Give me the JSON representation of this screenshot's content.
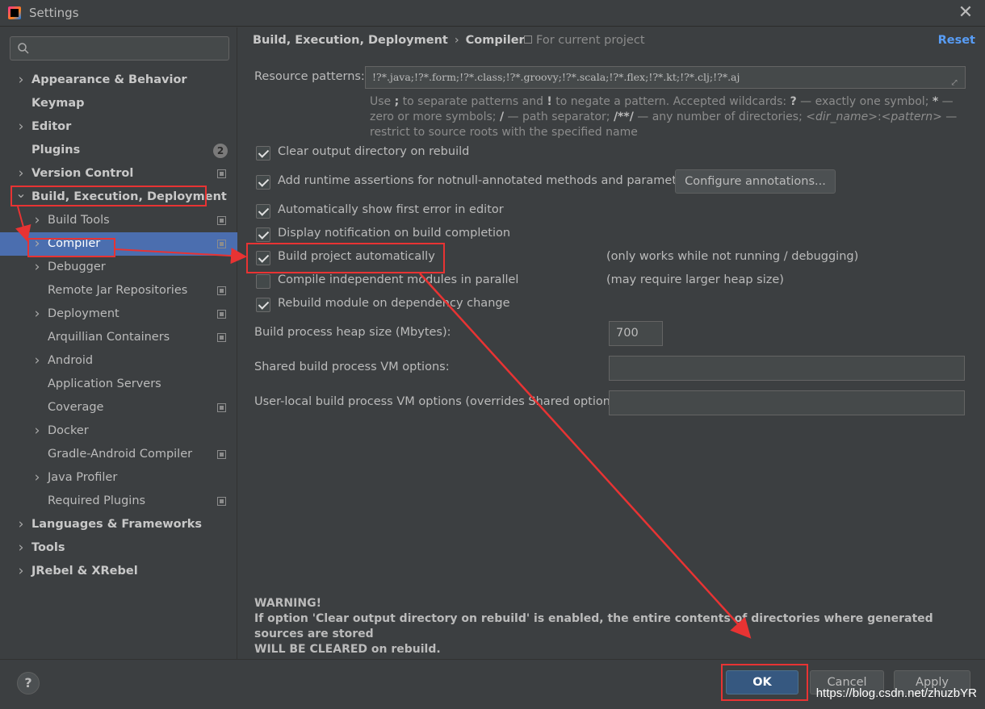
{
  "window": {
    "title": "Settings",
    "close_glyph": "✕"
  },
  "search": {
    "placeholder": "",
    "icon": "search-icon"
  },
  "sidebar": {
    "items": [
      {
        "label": "Appearance & Behavior",
        "expandable": true,
        "bold": true,
        "level": 0
      },
      {
        "label": "Keymap",
        "expandable": false,
        "bold": true,
        "level": 0
      },
      {
        "label": "Editor",
        "expandable": true,
        "bold": true,
        "level": 0
      },
      {
        "label": "Plugins",
        "expandable": false,
        "bold": true,
        "level": 0,
        "badge": "2"
      },
      {
        "label": "Version Control",
        "expandable": true,
        "bold": true,
        "level": 0,
        "project_icon": true
      },
      {
        "label": "Build, Execution, Deployment",
        "expandable": true,
        "expanded": true,
        "bold": true,
        "level": 0
      },
      {
        "label": "Build Tools",
        "expandable": true,
        "level": 1,
        "project_icon": true
      },
      {
        "label": "Compiler",
        "expandable": true,
        "level": 1,
        "project_icon": true,
        "selected": true
      },
      {
        "label": "Debugger",
        "expandable": true,
        "level": 1
      },
      {
        "label": "Remote Jar Repositories",
        "expandable": false,
        "level": 1,
        "project_icon": true
      },
      {
        "label": "Deployment",
        "expandable": true,
        "level": 1,
        "project_icon": true
      },
      {
        "label": "Arquillian Containers",
        "expandable": false,
        "level": 1,
        "project_icon": true
      },
      {
        "label": "Android",
        "expandable": true,
        "level": 1
      },
      {
        "label": "Application Servers",
        "expandable": false,
        "level": 1
      },
      {
        "label": "Coverage",
        "expandable": false,
        "level": 1,
        "project_icon": true
      },
      {
        "label": "Docker",
        "expandable": true,
        "level": 1
      },
      {
        "label": "Gradle-Android Compiler",
        "expandable": false,
        "level": 1,
        "project_icon": true
      },
      {
        "label": "Java Profiler",
        "expandable": true,
        "level": 1
      },
      {
        "label": "Required Plugins",
        "expandable": false,
        "level": 1,
        "project_icon": true
      },
      {
        "label": "Languages & Frameworks",
        "expandable": true,
        "bold": true,
        "level": 0
      },
      {
        "label": "Tools",
        "expandable": true,
        "bold": true,
        "level": 0
      },
      {
        "label": "JRebel & XRebel",
        "expandable": true,
        "bold": true,
        "level": 0
      }
    ]
  },
  "header": {
    "crumb_parent": "Build, Execution, Deployment",
    "crumb_separator": "›",
    "crumb_current": "Compiler",
    "scope": "For current project",
    "reset_label": "Reset"
  },
  "resource": {
    "label": "Resource patterns:",
    "value": "!?*.java;!?*.form;!?*.class;!?*.groovy;!?*.scala;!?*.flex;!?*.kt;!?*.clj;!?*.aj",
    "hint_1": "Use ",
    "hint_2": ";",
    "hint_3": " to separate patterns and ",
    "hint_4": "!",
    "hint_5": " to negate a pattern. Accepted wildcards: ",
    "hint_6": "?",
    "hint_7": " — exactly one symbol; ",
    "hint_8": "*",
    "hint_9": " — zero or more symbols; ",
    "hint_10": "/",
    "hint_11": " — path separator; ",
    "hint_12": "/**/",
    "hint_13": " — any number of directories; ",
    "hint_14": "<dir_name>",
    "hint_15": ":",
    "hint_16": "<pattern>",
    "hint_17": " — restrict to source roots with the specified name"
  },
  "options": {
    "clear_output": {
      "label": "Clear output directory on rebuild",
      "checked": true
    },
    "runtime_assertions": {
      "label": "Add runtime assertions for notnull-annotated methods and parameters",
      "checked": true
    },
    "configure_annotations": "Configure annotations...",
    "show_first_error": {
      "label": "Automatically show first error in editor",
      "checked": true
    },
    "display_notification": {
      "label": "Display notification on build completion",
      "checked": true
    },
    "build_auto": {
      "label": "Build project automatically",
      "checked": true,
      "note": "(only works while not running / debugging)"
    },
    "compile_parallel": {
      "label": "Compile independent modules in parallel",
      "checked": false,
      "note": "(may require larger heap size)"
    },
    "rebuild_dependency": {
      "label": "Rebuild module on dependency change",
      "checked": true
    }
  },
  "heap": {
    "label": "Build process heap size (Mbytes):",
    "value": "700"
  },
  "shared_vm": {
    "label": "Shared build process VM options:",
    "value": ""
  },
  "user_vm": {
    "label": "User-local build process VM options (overrides Shared options):",
    "value": ""
  },
  "warning": {
    "title": "WARNING!",
    "line1": "If option 'Clear output directory on rebuild' is enabled, the entire contents of directories where generated sources are stored",
    "line2": "WILL BE CLEARED on rebuild."
  },
  "footer": {
    "help_label": "?",
    "ok_label": "OK",
    "cancel_label": "Cancel",
    "apply_label": "Apply",
    "watermark": "https://blog.csdn.net/zhuzbYR"
  },
  "colors": {
    "accent": "#4b6eaf",
    "annotation": "#e83333",
    "link": "#589df6",
    "primary_button": "#365880"
  }
}
